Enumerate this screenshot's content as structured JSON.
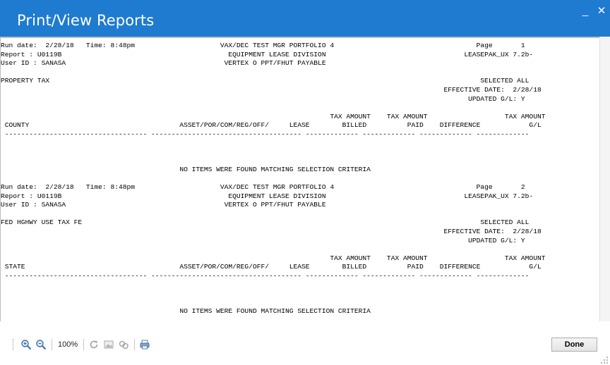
{
  "window": {
    "title": "Print/View Reports",
    "minimize_glyph": "_",
    "close_glyph": "✕",
    "accent_color": "#1e7bd0"
  },
  "report": {
    "page1_lines": [
      "Run date:  2/28/18   Time: 8:48pm                     VAX/DEC TEST MGR PORTFOLIO 4                                   Page       1",
      "Report : U0119B                                         EQUIPMENT LEASE DIVISION                                  LEASEPAK_UX 7.2b-",
      "User ID : SANASA                                       VERTEX O PPT/FHUT PAYABLE",
      "",
      "PROPERTY TAX                                                                                                          SELECTED ALL",
      "                                                                                                             EFFECTIVE DATE:  2/28/18",
      "                                                                                                                   UPDATED G/L: Y",
      "",
      "                                                                                 TAX AMOUNT    TAX AMOUNT                   TAX AMOUNT",
      " COUNTY                                     ASSET/POR/COM/REG/OFF/     LEASE        BILLED          PAID    DIFFERENCE            G/L",
      " ----------------------------------- ------------------------------------- ------------- ------------- ------------- -------------",
      "",
      "",
      "",
      "                                            NO ITEMS WERE FOUND MATCHING SELECTION CRITERIA"
    ],
    "page2_lines": [
      "Run date:  2/28/18   Time: 8:48pm                     VAX/DEC TEST MGR PORTFOLIO 4                                   Page       2",
      "Report : U0119B                                         EQUIPMENT LEASE DIVISION                                  LEASEPAK_UX 7.2b-",
      "User ID : SANASA                                       VERTEX O PPT/FHUT PAYABLE",
      "",
      "FED HGHWY USE TAX FE                                                                                                  SELECTED ALL",
      "                                                                                                             EFFECTIVE DATE:  2/28/18",
      "                                                                                                                   UPDATED G/L: Y",
      "",
      "                                                                                 TAX AMOUNT    TAX AMOUNT                   TAX AMOUNT",
      " STATE                                      ASSET/POR/COM/REG/OFF/     LEASE        BILLED          PAID    DIFFERENCE            G/L",
      " ----------------------------------- ------------------------------------- ------------- ------------- ------------- -------------",
      "",
      "",
      "",
      "                                            NO ITEMS WERE FOUND MATCHING SELECTION CRITERIA"
    ]
  },
  "toolbar": {
    "zoom_level": "100%",
    "zoom_in_icon": "zoom-in-icon",
    "zoom_out_icon": "zoom-out-icon",
    "refresh_icon": "refresh-icon",
    "image_icon": "image-icon",
    "links_icon": "link-icon",
    "print_icon": "print-icon"
  },
  "footer": {
    "done_label": "Done"
  }
}
